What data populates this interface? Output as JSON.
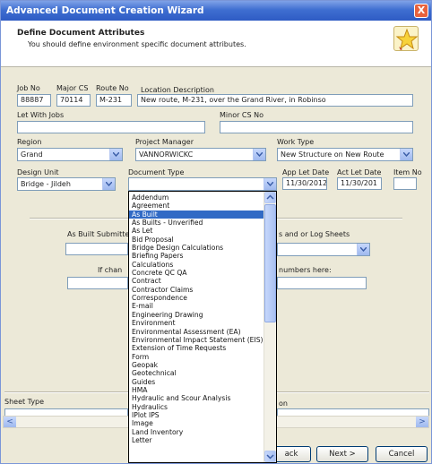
{
  "window": {
    "title": "Advanced Document Creation Wizard",
    "close_glyph": "X"
  },
  "header": {
    "title": "Define Document Attributes",
    "subtitle": "You should define environment specific document attributes."
  },
  "fields": {
    "job_no": {
      "label": "Job No",
      "value": "88887"
    },
    "major_cs": {
      "label": "Major CS",
      "value": "70114"
    },
    "route_no": {
      "label": "Route No",
      "value": "M-231"
    },
    "location_description": {
      "label": "Location Description",
      "value": "New route, M-231, over the Grand River, in Robinso"
    },
    "let_with_jobs": {
      "label": "Let With Jobs",
      "value": ""
    },
    "minor_cs_no": {
      "label": "Minor CS No",
      "value": ""
    },
    "region": {
      "label": "Region",
      "value": "Grand"
    },
    "project_manager": {
      "label": "Project Manager",
      "value": "VANNORWICKC"
    },
    "work_type": {
      "label": "Work Type",
      "value": "New Structure on New Route"
    },
    "design_unit": {
      "label": "Design Unit",
      "value": "Bridge - Jildeh"
    },
    "document_type": {
      "label": "Document Type",
      "value": ""
    },
    "app_let_date": {
      "label": "App Let Date",
      "value": "11/30/2012"
    },
    "act_let_date": {
      "label": "Act Let Date",
      "value": "11/30/201"
    },
    "item_no": {
      "label": "Item No",
      "value": ""
    },
    "as_built_submitted": {
      "label": "As Built Submitte"
    },
    "log_sheets": {
      "label": "s and or Log Sheets"
    },
    "if_chan": {
      "label": "If chan"
    },
    "numbers_here": {
      "label": "numbers here:"
    },
    "sheet_type": {
      "label": "Sheet Type"
    },
    "on_label": {
      "label": "on"
    }
  },
  "dropdown": {
    "selected": "As Built",
    "items": [
      "Addendum",
      "Agreement",
      "As Built",
      "As Builts - Unverified",
      "As Let",
      "Bid Proposal",
      "Bridge Design Calculations",
      "Briefing Papers",
      "Calculations",
      "Concrete QC QA",
      "Contract",
      "Contractor Claims",
      "Correspondence",
      "E-mail",
      "Engineering Drawing",
      "Environment",
      "Environmental Assessment (EA)",
      "Environmental Impact Statement (EIS)",
      "Extension of Time Requests",
      "Form",
      "Geopak",
      "Geotechnical",
      "Guides",
      "HMA",
      "Hydraulic and Scour Analysis",
      "Hydraulics",
      "IPlot IPS",
      "Image",
      "Land Inventory",
      "Letter"
    ]
  },
  "buttons": {
    "back": "ack",
    "next": "Next >",
    "cancel": "Cancel"
  },
  "scrollbar": {
    "left_glyph": "<",
    "right_glyph": ">"
  }
}
